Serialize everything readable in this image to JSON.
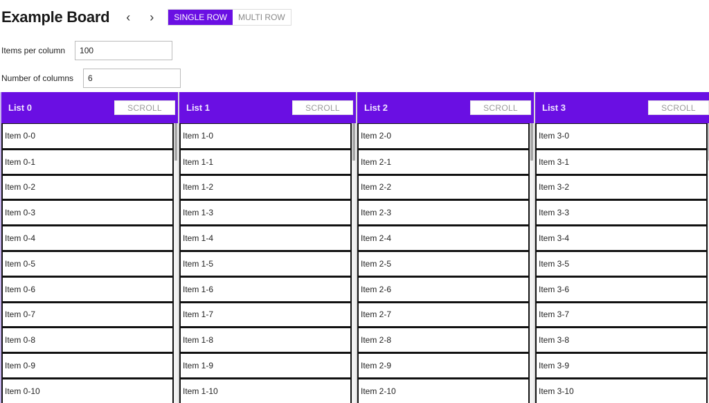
{
  "header": {
    "title": "Example Board",
    "prev_icon": "chevron-left-icon",
    "prev_glyph": "‹",
    "next_icon": "chevron-right-icon",
    "next_glyph": "›",
    "view_modes": [
      {
        "label": "SINGLE ROW",
        "active": true
      },
      {
        "label": "MULTI ROW",
        "active": false
      }
    ]
  },
  "settings": {
    "items_per_column": {
      "label": "Items per column",
      "value": "100"
    },
    "number_of_columns": {
      "label": "Number of columns",
      "value": "6"
    }
  },
  "colors": {
    "accent": "#6a0fe3"
  },
  "lists": [
    {
      "title": "List 0",
      "scroll_label": "SCROLL",
      "items": [
        "Item 0-0",
        "Item 0-1",
        "Item 0-2",
        "Item 0-3",
        "Item 0-4",
        "Item 0-5",
        "Item 0-6",
        "Item 0-7",
        "Item 0-8",
        "Item 0-9",
        "Item 0-10"
      ]
    },
    {
      "title": "List 1",
      "scroll_label": "SCROLL",
      "items": [
        "Item 1-0",
        "Item 1-1",
        "Item 1-2",
        "Item 1-3",
        "Item 1-4",
        "Item 1-5",
        "Item 1-6",
        "Item 1-7",
        "Item 1-8",
        "Item 1-9",
        "Item 1-10"
      ]
    },
    {
      "title": "List 2",
      "scroll_label": "SCROLL",
      "items": [
        "Item 2-0",
        "Item 2-1",
        "Item 2-2",
        "Item 2-3",
        "Item 2-4",
        "Item 2-5",
        "Item 2-6",
        "Item 2-7",
        "Item 2-8",
        "Item 2-9",
        "Item 2-10"
      ]
    },
    {
      "title": "List 3",
      "scroll_label": "SCROLL",
      "items": [
        "Item 3-0",
        "Item 3-1",
        "Item 3-2",
        "Item 3-3",
        "Item 3-4",
        "Item 3-5",
        "Item 3-6",
        "Item 3-7",
        "Item 3-8",
        "Item 3-9",
        "Item 3-10"
      ]
    }
  ]
}
